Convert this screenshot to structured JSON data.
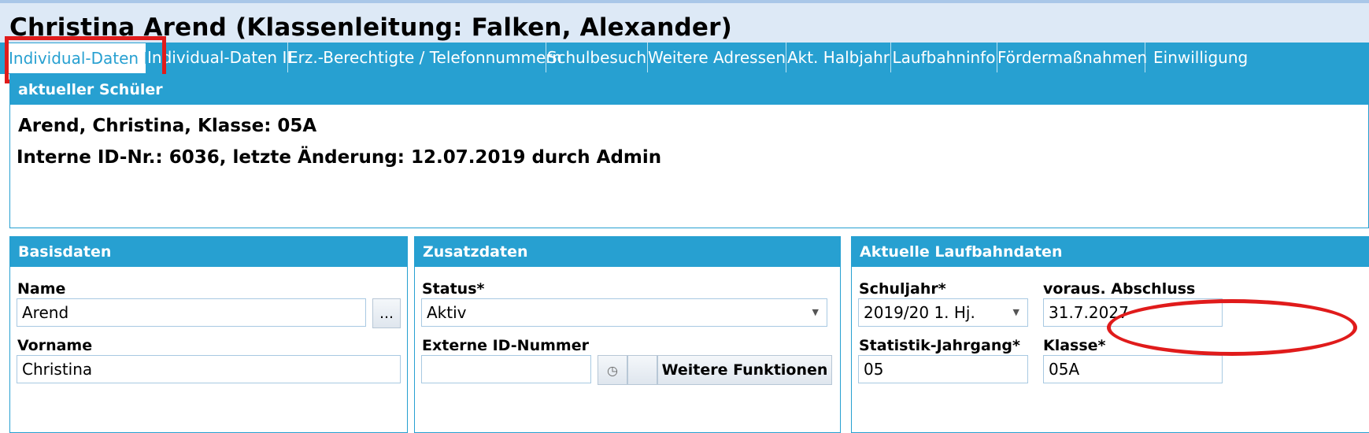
{
  "header": {
    "title": "Christina Arend (Klassenleitung: Falken, Alexander)"
  },
  "tabs": [
    "Individual-Daten I",
    "Individual-Daten II",
    "Erz.-Berechtigte / Telefonnummern",
    "Schulbesuch",
    "Weitere Adressen",
    "Akt. Halbjahr",
    "Laufbahninfo",
    "Fördermaßnahmen",
    "Einwilligung"
  ],
  "current_student": {
    "heading": "aktueller Schüler",
    "line1": "Arend, Christina, Klasse: 05A",
    "line2": "Interne ID-Nr.: 6036, letzte Änderung: 12.07.2019 durch Admin"
  },
  "basisdaten": {
    "heading": "Basisdaten",
    "name_label": "Name",
    "name_value": "Arend",
    "more_button": "...",
    "vorname_label": "Vorname",
    "vorname_value": "Christina"
  },
  "zusatzdaten": {
    "heading": "Zusatzdaten",
    "status_label": "Status*",
    "status_value": "Aktiv",
    "extid_label": "Externe ID-Nummer",
    "extid_value": "",
    "weitere_button": "Weitere Funktionen"
  },
  "laufbahn": {
    "heading": "Aktuelle Laufbahndaten",
    "schuljahr_label": "Schuljahr*",
    "schuljahr_value": "2019/20 1. Hj.",
    "abschluss_label": "voraus. Abschluss",
    "abschluss_value": "31.7.2027",
    "jahrgang_label": "Statistik-Jahrgang*",
    "jahrgang_value": "05",
    "klasse_label": "Klasse*",
    "klasse_value": "05A"
  },
  "colors": {
    "accent": "#27a0d1",
    "highlight": "#e01b1b",
    "header_bg": "#dde9f6"
  },
  "icons": {
    "dropdown": "chevron-down-icon",
    "clock": "clock-icon"
  }
}
